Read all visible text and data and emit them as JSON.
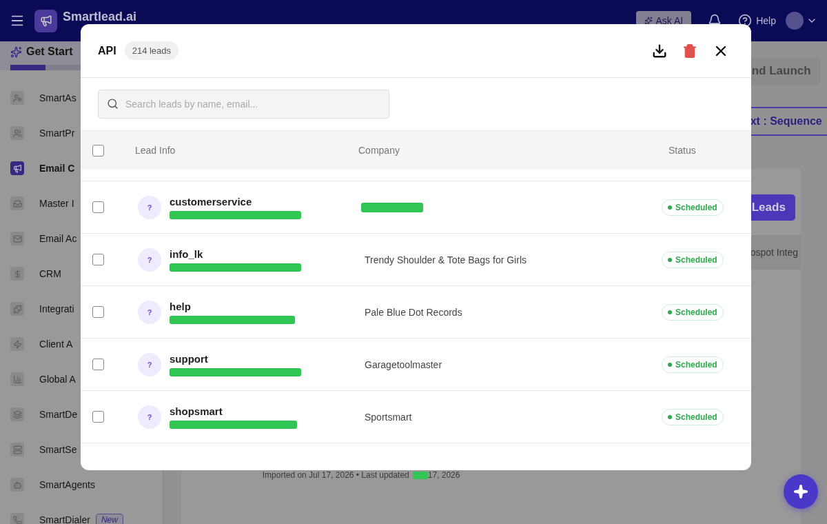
{
  "header": {
    "brand": "Smartlead.ai",
    "ask_ai": "Ask AI",
    "help": "Help"
  },
  "sidebar": {
    "get_started": {
      "label": "Get Start",
      "level": 0.5
    },
    "items": [
      {
        "label": "SmartAs",
        "selected": false
      },
      {
        "label": "SmartPr",
        "selected": false
      },
      {
        "label": "Email C",
        "selected": true
      },
      {
        "label": "Master I",
        "selected": false
      },
      {
        "label": "Email Ac",
        "selected": false
      },
      {
        "label": "CRM",
        "selected": false
      },
      {
        "label": "Integrati",
        "selected": false
      },
      {
        "label": "Client A",
        "selected": false
      },
      {
        "label": "Global A",
        "selected": false
      },
      {
        "label": "SmartDe",
        "selected": false
      },
      {
        "label": "SmartSe",
        "selected": false
      },
      {
        "label": "SmartAgents",
        "selected": false
      },
      {
        "label": "SmartDialer",
        "selected": false,
        "badge": "New"
      }
    ]
  },
  "page": {
    "launch_button": "nd Launch",
    "sequence_tab": "xt : Sequence",
    "leads_button": "Leads",
    "integration_cell": "ospot Integ",
    "imported_text": "Imported on Jul 17, 2026 • Last updated",
    "imported_date": "17, 2026"
  },
  "modal": {
    "title": "API",
    "count": "214 leads",
    "search": {
      "placeholder": "Search leads by name, email..."
    },
    "all_checked": false,
    "columns": [
      "Lead Info",
      "Company",
      "Status"
    ],
    "rows": [
      {
        "avatar": "?",
        "name": "customerservice",
        "email_hidden": true,
        "company": null,
        "company_hidden": true,
        "status": "Scheduled",
        "checked": false
      },
      {
        "avatar": "?",
        "name": "info_lk",
        "email_hidden": true,
        "company": "Trendy Shoulder & Tote Bags for Girls",
        "company_hidden": false,
        "status": "Scheduled",
        "checked": false
      },
      {
        "avatar": "?",
        "name": "help",
        "email_hidden": true,
        "company": "Pale Blue Dot Records",
        "company_hidden": false,
        "status": "Scheduled",
        "checked": false
      },
      {
        "avatar": "?",
        "name": "support",
        "email_hidden": true,
        "company": "Garagetoolmaster",
        "company_hidden": false,
        "status": "Scheduled",
        "checked": false
      },
      {
        "avatar": "?",
        "name": "shopsmart",
        "email_hidden": true,
        "company": "Sportsmart",
        "company_hidden": false,
        "status": "Scheduled",
        "checked": false
      }
    ]
  }
}
